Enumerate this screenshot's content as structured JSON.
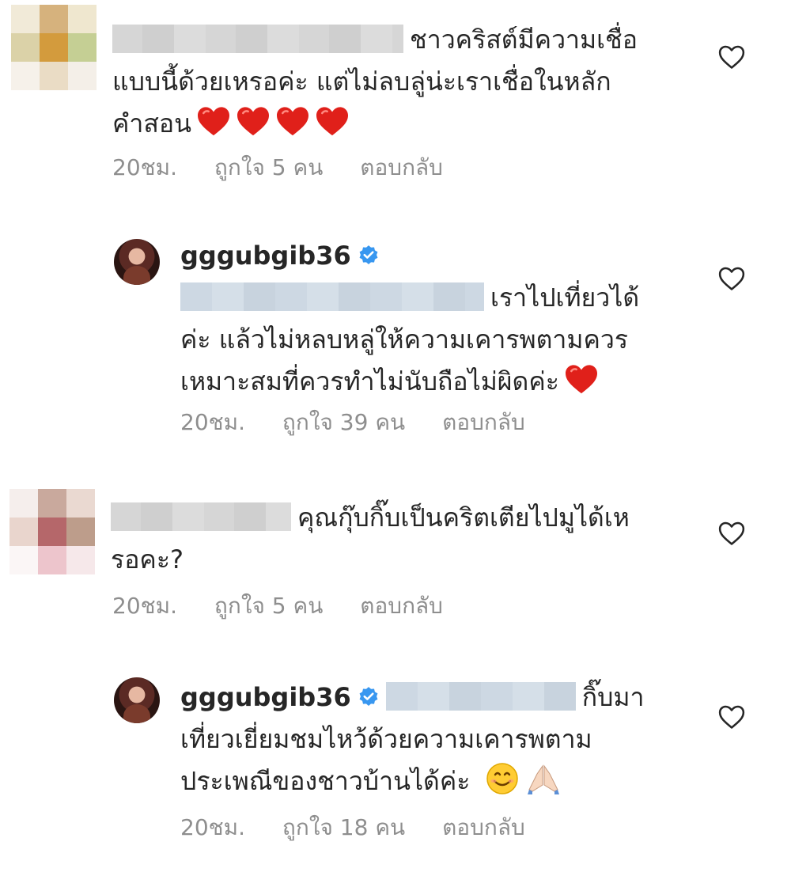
{
  "comments": [
    {
      "text_line1": "ชาวคริสต์มีความเชื่อ",
      "text_line2": "แบบนี้ด้วยเหรอค่ะ แต่ไม่ลบลู่น่ะเราเชื่อในหลัก",
      "text_line3": "คำสอน",
      "emoji": "heart-emoji x4",
      "time": "20ชม.",
      "likes": "ถูกใจ 5 คน",
      "reply": "ตอบกลับ"
    },
    {
      "username": "gggubgib36",
      "verified": true,
      "text_line1": "เราไปเที่ยวได้",
      "text_line2": "ค่ะ แล้วไม่หลบหลู่ให้ความเคารพตามควร",
      "text_line3": "เหมาะสมที่ควรทำไม่นับถือไม่ผิดค่ะ",
      "emoji": "heart-emoji",
      "time": "20ชม.",
      "likes": "ถูกใจ 39 คน",
      "reply": "ตอบกลับ"
    },
    {
      "text_line1": "คุณกุ๊บกิ๊บเป็นคริตเตียไปมูได้เห",
      "text_line2": "รอคะ?",
      "time": "20ชม.",
      "likes": "ถูกใจ 5 คน",
      "reply": "ตอบกลับ"
    },
    {
      "username": "gggubgib36",
      "verified": true,
      "text_line1": "กิ๊บมา",
      "text_line2": "เที่ยวเยี่ยมชมไหว้ด้วยความเคารพตาม",
      "text_line3": "ประเพณีของชาวบ้านได้ค่ะ",
      "emoji": "smile-emoji, folded-hands-emoji",
      "time": "20ชม.",
      "likes": "ถูกใจ 18 คน",
      "reply": "ตอบกลับ"
    }
  ],
  "colors": {
    "text": "#262626",
    "meta": "#8e8e8e",
    "verified": "#3897f0",
    "heart_emoji": "#e0201a"
  }
}
